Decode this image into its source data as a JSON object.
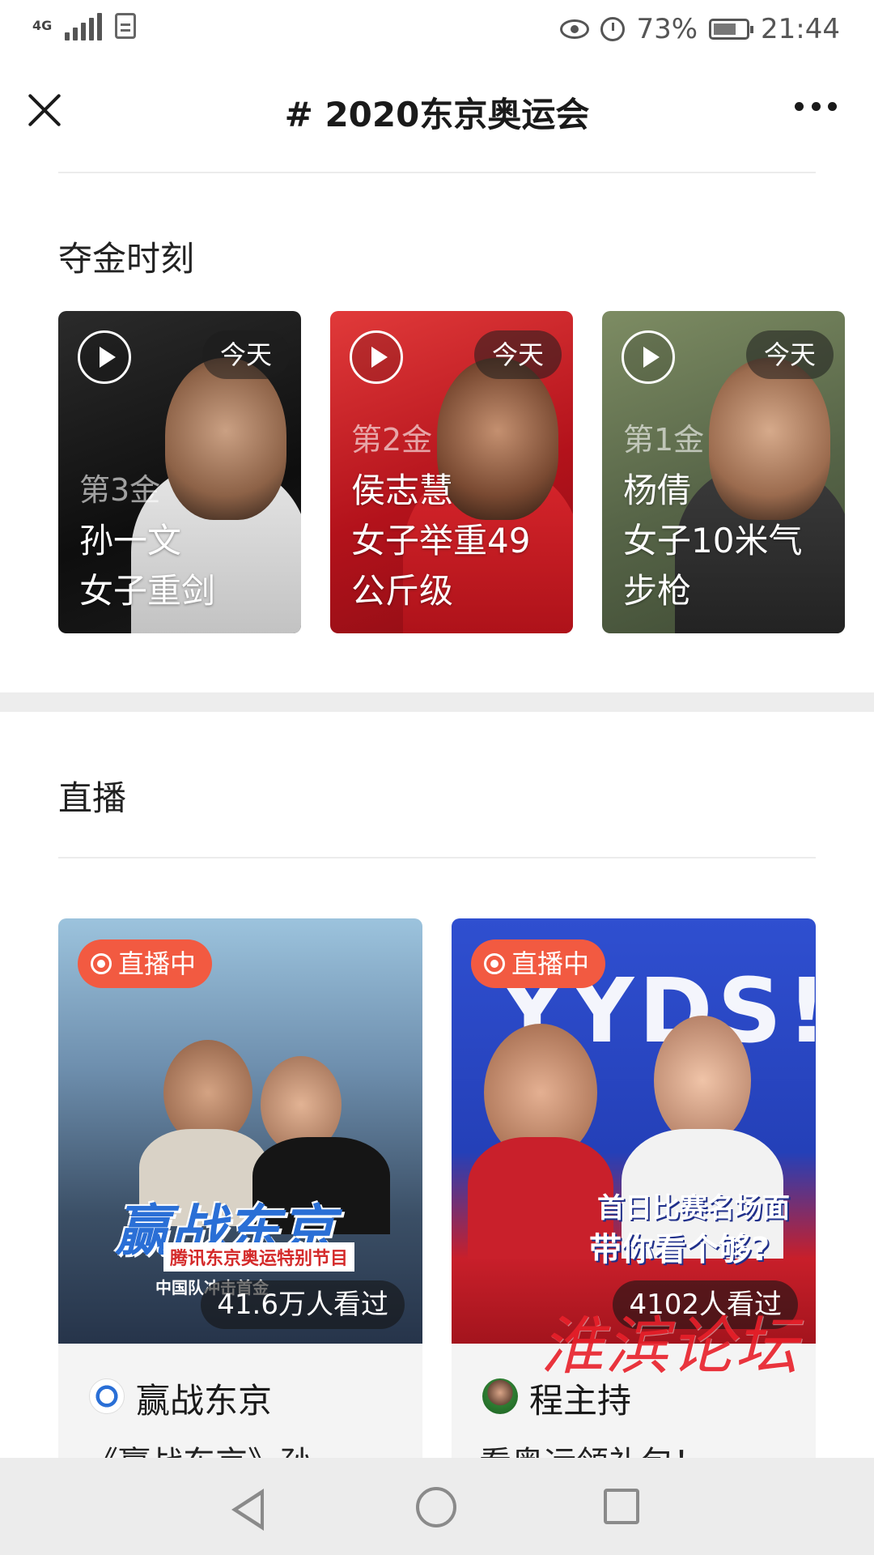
{
  "status_bar": {
    "network": "4G",
    "battery_pct": "73%",
    "time": "21:44"
  },
  "nav": {
    "title": "# 2020东京奥运会"
  },
  "gold_section": {
    "title": "夺金时刻",
    "cards": [
      {
        "badge": "今天",
        "rank": "第3金",
        "name": "孙一文",
        "event_line1": "女子重剑",
        "event_line2": "",
        "colors": {
          "bg": "#161616",
          "accent": "#e9e9e9"
        }
      },
      {
        "badge": "今天",
        "rank": "第2金",
        "name": "侯志慧",
        "event_line1": "女子举重49",
        "event_line2": "公斤级",
        "colors": {
          "bg": "#b3121b",
          "accent": "#d8262c"
        }
      },
      {
        "badge": "今天",
        "rank": "第1金",
        "name": "杨倩",
        "event_line1": "女子10米气",
        "event_line2": "步枪",
        "colors": {
          "bg": "#5a6a4c",
          "accent": "#8a9b72"
        }
      }
    ]
  },
  "live_section": {
    "title": "直播",
    "cards": [
      {
        "badge": "直播中",
        "viewers": "41.6万人看过",
        "host": "赢战东京",
        "desc": "《赢战东京》孙",
        "thumb_caption": "赢战东京",
        "thumb_sub": "腾讯东京奥运特别节目",
        "thumb_sub2": "中国队冲击首金",
        "colors": {
          "bg": "#5b7c9e",
          "accent": "#2a5fb0"
        }
      },
      {
        "badge": "直播中",
        "viewers": "4102人看过",
        "host": "程主持",
        "desc": "看奥运领礼包！",
        "thumb_caption": "YYDS!",
        "thumb_sub": "首日比赛名场面",
        "thumb_sub2": "带你看个够?",
        "colors": {
          "bg": "#2440b8",
          "accent": "#d8242c"
        }
      }
    ]
  },
  "watermark": "淮滨论坛"
}
